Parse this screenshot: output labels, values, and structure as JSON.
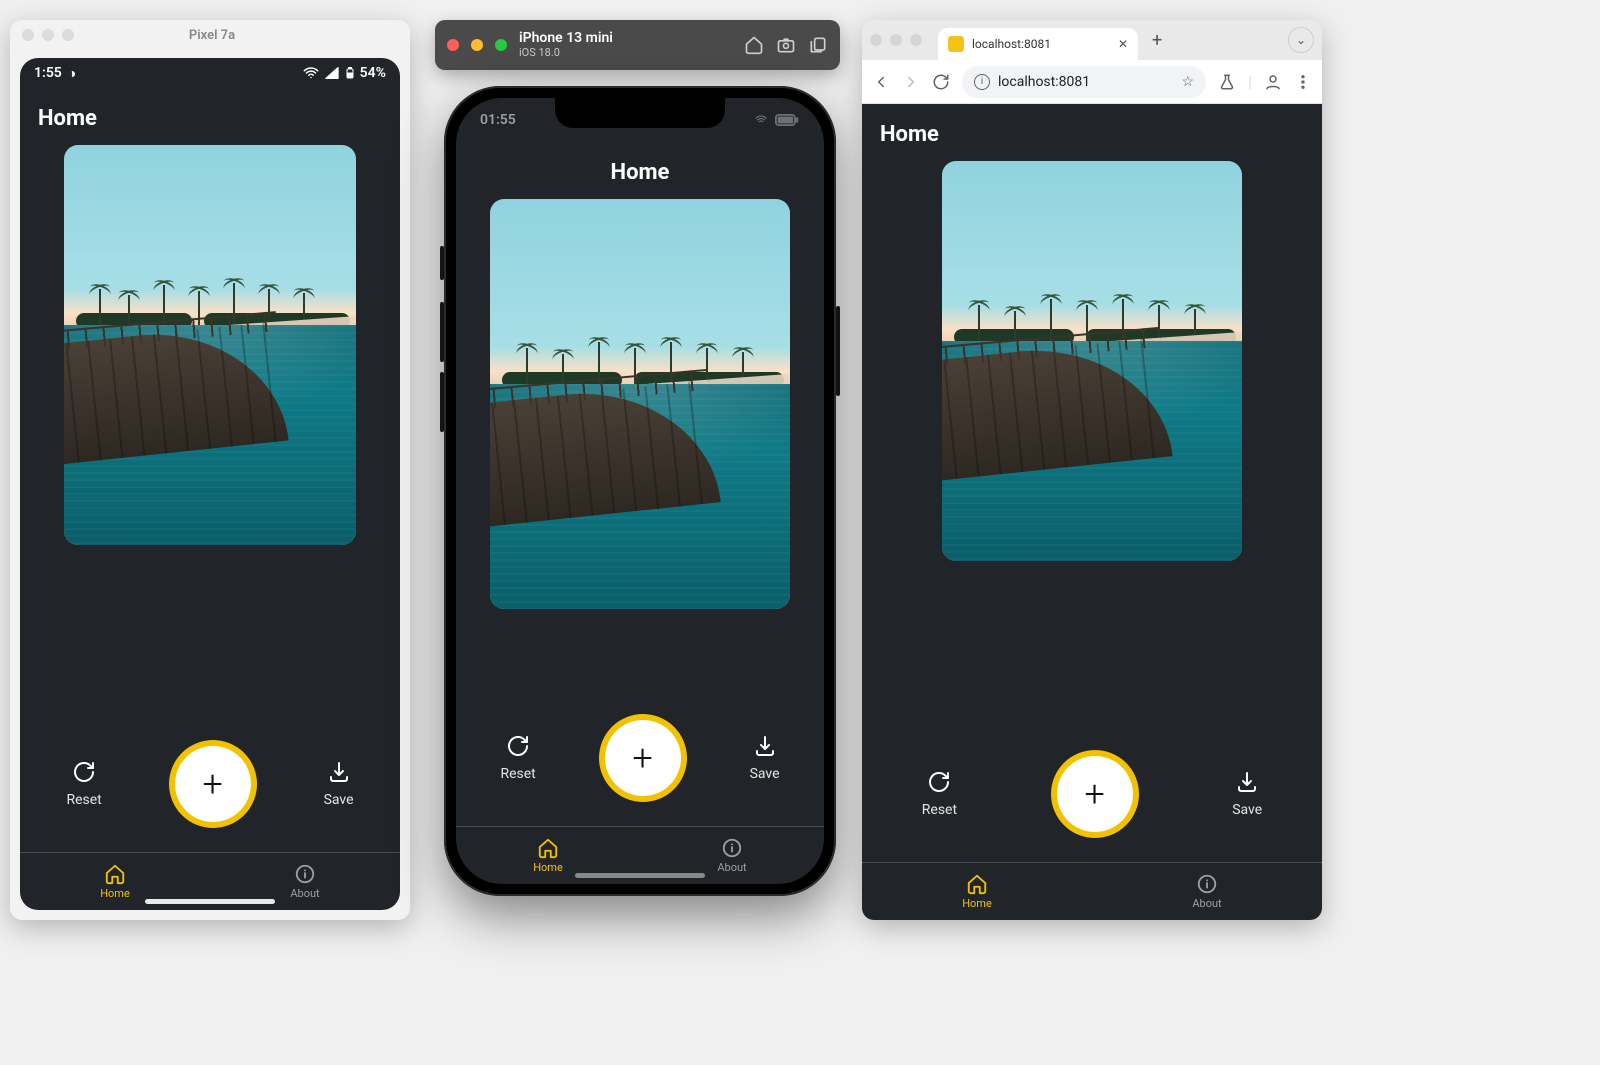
{
  "panels": {
    "android": {
      "window_title": "Pixel 7a",
      "status": {
        "time": "1:55",
        "battery": "54%"
      }
    },
    "ios": {
      "device_name": "iPhone 13 mini",
      "os_version": "iOS 18.0",
      "status_time": "01:55"
    },
    "chrome": {
      "tab_title": "localhost:8081",
      "address": "localhost:8081"
    }
  },
  "app": {
    "title": "Home",
    "actions": {
      "reset": "Reset",
      "save": "Save"
    },
    "tabs": {
      "home": "Home",
      "about": "About"
    }
  }
}
